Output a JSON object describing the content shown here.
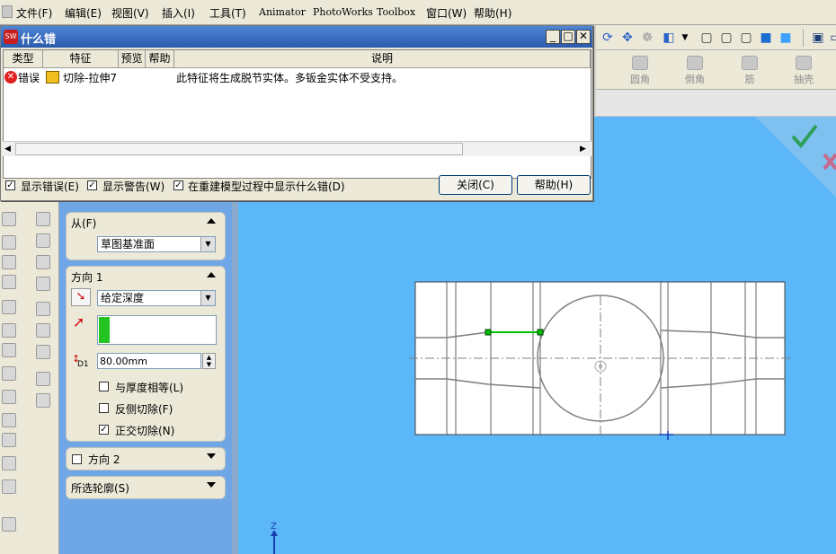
{
  "menubar": {
    "items": [
      "文件(F)",
      "编辑(E)",
      "视图(V)",
      "插入(I)",
      "工具(T)",
      "Animator",
      "PhotoWorks",
      "Toolbox",
      "窗口(W)",
      "帮助(H)"
    ]
  },
  "feature_toolbar": {
    "items": [
      "圆角",
      "倒角",
      "筋",
      "抽壳"
    ]
  },
  "dialog": {
    "title": "什么错",
    "columns": [
      "类型",
      "特征",
      "预览",
      "帮助",
      "说明"
    ],
    "rows": [
      {
        "type": "错误",
        "feature": "切除-拉伸7",
        "preview": "",
        "help": "",
        "description": "此特征将生成脱节实体。多钣金实体不受支持。"
      }
    ],
    "show_errors": "显示错误(E)",
    "show_warnings": "显示警告(W)",
    "show_on_rebuild": "在重建模型过程中显示什么错(D)",
    "close_btn": "关闭(C)",
    "help_btn": "帮助(H)"
  },
  "property_manager": {
    "from_group": {
      "title": "从(F)",
      "value": "草图基准面"
    },
    "direction1": {
      "title": "方向 1",
      "end_condition": "给定深度",
      "depth": "80.00mm",
      "depth_label": "D1",
      "equal_thickness": "与厚度相等(L)",
      "flip_side": "反侧切除(F)",
      "normal_cut": "正交切除(N)",
      "normal_cut_checked": true
    },
    "direction2": {
      "title": "方向 2"
    },
    "selected_contours": {
      "title": "所选轮廓(S)"
    }
  },
  "viewport": {
    "axis_label": "Z"
  },
  "colors": {
    "viewport_bg": "#5bb7f7",
    "title_bar": "#2a5aab",
    "depth_indicator": "#22c422",
    "selected_edge": "#00c000"
  }
}
